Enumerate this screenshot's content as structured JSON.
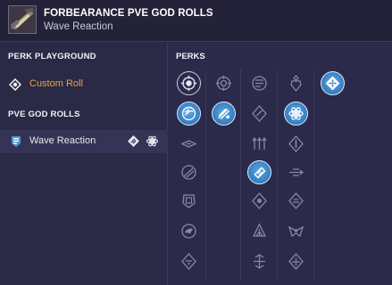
{
  "header": {
    "title": "FORBEARANCE PVE GOD ROLLS",
    "subtitle": "Wave Reaction",
    "weapon_icon": "weapon-thumbnail"
  },
  "left_panel": {
    "perk_playground_label": "PERK PLAYGROUND",
    "custom_roll_label": "Custom Roll",
    "pve_god_rolls_label": "PVE GOD ROLLS",
    "rolls": [
      {
        "label": "Wave Reaction",
        "icon": "shield-icon",
        "actions": [
          "diamond-perk-icon",
          "atom-icon"
        ]
      }
    ]
  },
  "perks_panel": {
    "label": "PERKS",
    "columns": [
      {
        "perks": [
          "crosshair-globe-perk",
          "frame-perk",
          "swirl-perk",
          "grip-perk",
          "radial-perk",
          "barrel-perk",
          "armor-perk"
        ],
        "selected": [
          1
        ],
        "hollow": [
          0
        ]
      },
      {
        "perks": [
          "crosshair-perk",
          "comet-perk"
        ],
        "selected": [
          1
        ]
      },
      {
        "perks": [
          "magazine-perk",
          "diamond-perk",
          "triple-arrow-perk",
          "ammo-perk",
          "shield-perk",
          "triangle-perk",
          "arrow-stack-perk"
        ],
        "selected": [
          3
        ]
      },
      {
        "perks": [
          "grenade-perk",
          "atom-perk",
          "hex-perk",
          "bolt-perk",
          "gauge-perk",
          "alien-perk",
          "burst-perk"
        ],
        "selected": [
          1
        ]
      },
      {
        "perks": [
          "origin-perk"
        ],
        "selected": [
          0
        ]
      }
    ]
  },
  "colors": {
    "accent_orange": "#e8a83a",
    "selected_blue": "#3b82c4",
    "background": "#2b2a4a"
  }
}
